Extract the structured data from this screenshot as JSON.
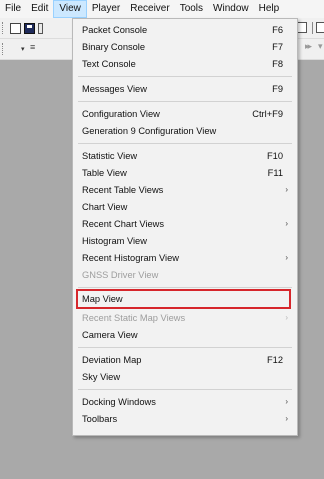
{
  "menubar": {
    "items": [
      {
        "label": "File"
      },
      {
        "label": "Edit"
      },
      {
        "label": "View"
      },
      {
        "label": "Player"
      },
      {
        "label": "Receiver"
      },
      {
        "label": "Tools"
      },
      {
        "label": "Window"
      },
      {
        "label": "Help"
      }
    ],
    "active_index": 2
  },
  "view_menu": {
    "items": [
      {
        "label": "Packet Console",
        "shortcut": "F6"
      },
      {
        "label": "Binary Console",
        "shortcut": "F7"
      },
      {
        "label": "Text Console",
        "shortcut": "F8"
      },
      {
        "label": "Messages View",
        "shortcut": "F9"
      },
      {
        "label": "Configuration View",
        "shortcut": "Ctrl+F9"
      },
      {
        "label": "Generation 9 Configuration View",
        "shortcut": ""
      },
      {
        "label": "Statistic View",
        "shortcut": "F10"
      },
      {
        "label": "Table View",
        "shortcut": "F11"
      },
      {
        "label": "Recent Table Views",
        "submenu": true
      },
      {
        "label": "Chart View",
        "shortcut": ""
      },
      {
        "label": "Recent Chart Views",
        "submenu": true
      },
      {
        "label": "Histogram View",
        "shortcut": ""
      },
      {
        "label": "Recent Histogram View",
        "submenu": true
      },
      {
        "label": "GNSS Driver View",
        "disabled": true
      },
      {
        "label": "Map View",
        "highlighted": true
      },
      {
        "label": "Recent Static Map Views",
        "submenu": true,
        "disabled": true
      },
      {
        "label": "Camera View",
        "shortcut": ""
      },
      {
        "label": "Deviation Map",
        "shortcut": "F12"
      },
      {
        "label": "Sky View",
        "shortcut": ""
      },
      {
        "label": "Docking Windows",
        "submenu": true
      },
      {
        "label": "Toolbars",
        "submenu": true
      }
    ],
    "submenu_arrow": "›"
  },
  "toolbar": {
    "flash_glyph": "≡",
    "ff_glyph": "▸▸",
    "caret_glyph": "▾"
  },
  "colors": {
    "highlight_border": "#d6262b",
    "menu_active_bg": "#cce8ff",
    "workspace_bg": "#a9a9a9"
  }
}
